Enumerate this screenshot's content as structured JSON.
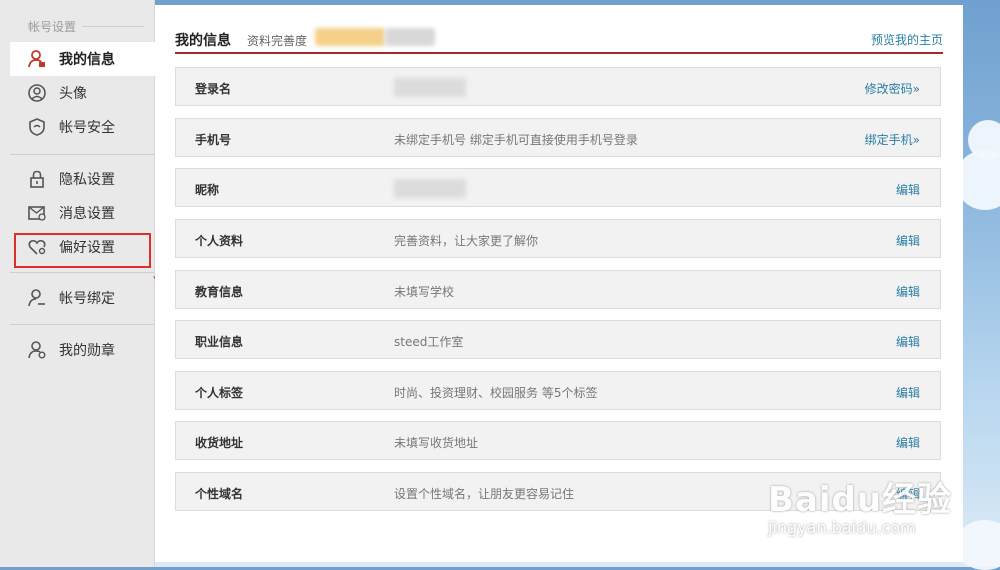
{
  "sidebar": {
    "section_title": "帐号设置",
    "items": [
      {
        "label": "我的信息",
        "icon": "user-icon",
        "active": true
      },
      {
        "label": "头像",
        "icon": "avatar-icon",
        "active": false
      },
      {
        "label": "帐号安全",
        "icon": "shield-icon",
        "active": false
      },
      {
        "label": "隐私设置",
        "icon": "lock-icon",
        "active": false
      },
      {
        "label": "消息设置",
        "icon": "message-icon",
        "active": false
      },
      {
        "label": "偏好设置",
        "icon": "heart-gear-icon",
        "active": false
      },
      {
        "label": "帐号绑定",
        "icon": "user-link-icon",
        "active": false
      },
      {
        "label": "我的勋章",
        "icon": "medal-icon",
        "active": false
      }
    ]
  },
  "header": {
    "title": "我的信息",
    "subtitle": "资料完善度",
    "preview_link": "预览我的主页"
  },
  "rows": [
    {
      "label": "登录名",
      "value": "",
      "action": "修改密码»",
      "blurred": true
    },
    {
      "label": "手机号",
      "value": "未绑定手机号 绑定手机可直接使用手机号登录",
      "action": "绑定手机»",
      "blurred": false
    },
    {
      "label": "昵称",
      "value": "",
      "action": "编辑",
      "blurred": true
    },
    {
      "label": "个人资料",
      "value": "完善资料，让大家更了解你",
      "action": "编辑",
      "blurred": false
    },
    {
      "label": "教育信息",
      "value": "未填写学校",
      "action": "编辑",
      "blurred": false
    },
    {
      "label": "职业信息",
      "value": "steed工作室",
      "action": "编辑",
      "blurred": false
    },
    {
      "label": "个人标签",
      "value": "时尚、投资理财、校园服务 等5个标签",
      "action": "编辑",
      "blurred": false
    },
    {
      "label": "收货地址",
      "value": "未填写收货地址",
      "action": "编辑",
      "blurred": false
    },
    {
      "label": "个性域名",
      "value": "设置个性域名，让朋友更容易记住",
      "action": "编辑",
      "blurred": false
    }
  ],
  "watermark": {
    "logo": "Baidu经验",
    "url": "jingyan.baidu.com"
  },
  "colors": {
    "accent_red": "#a32a2a",
    "link_blue": "#2a7ea6",
    "annotation_red": "#d9302b"
  }
}
